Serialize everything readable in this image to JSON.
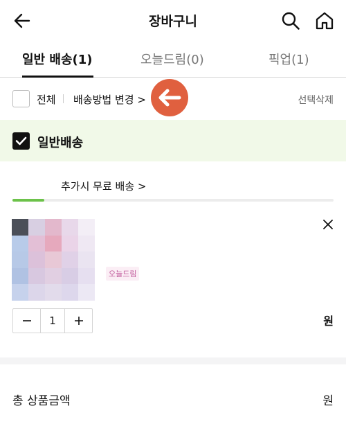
{
  "header": {
    "title": "장바구니",
    "back_icon": "arrow-left-icon",
    "search_icon": "search-icon",
    "home_icon": "home-icon"
  },
  "tabs": [
    {
      "label": "일반 배송(1)",
      "active": true
    },
    {
      "label": "오늘드림(0)",
      "active": false
    },
    {
      "label": "픽업(1)",
      "active": false
    }
  ],
  "toolbar": {
    "select_all_label": "전체",
    "shipping_method_label": "배송방법 변경 >",
    "delete_selected_label": "선택삭제",
    "select_all_checked": false
  },
  "section": {
    "label": "일반배송",
    "checked": true,
    "checked_color": "#111111",
    "background": "#f1f9e8"
  },
  "free_shipping": {
    "label": "추가시 무료 배송 >",
    "progress": 0.1,
    "progress_color": "#6cc24a"
  },
  "product": {
    "delivery_chip": "오늘드림",
    "quantity": "1",
    "price_unit": "원",
    "close_icon": "close-icon",
    "minus_icon": "minus-icon",
    "plus_icon": "plus-icon"
  },
  "summary": {
    "total_label": "총 상품금액",
    "total_unit": "원"
  },
  "overlay": {
    "badge_icon": "arrow-left-icon",
    "badge_color": "#e0603f"
  }
}
